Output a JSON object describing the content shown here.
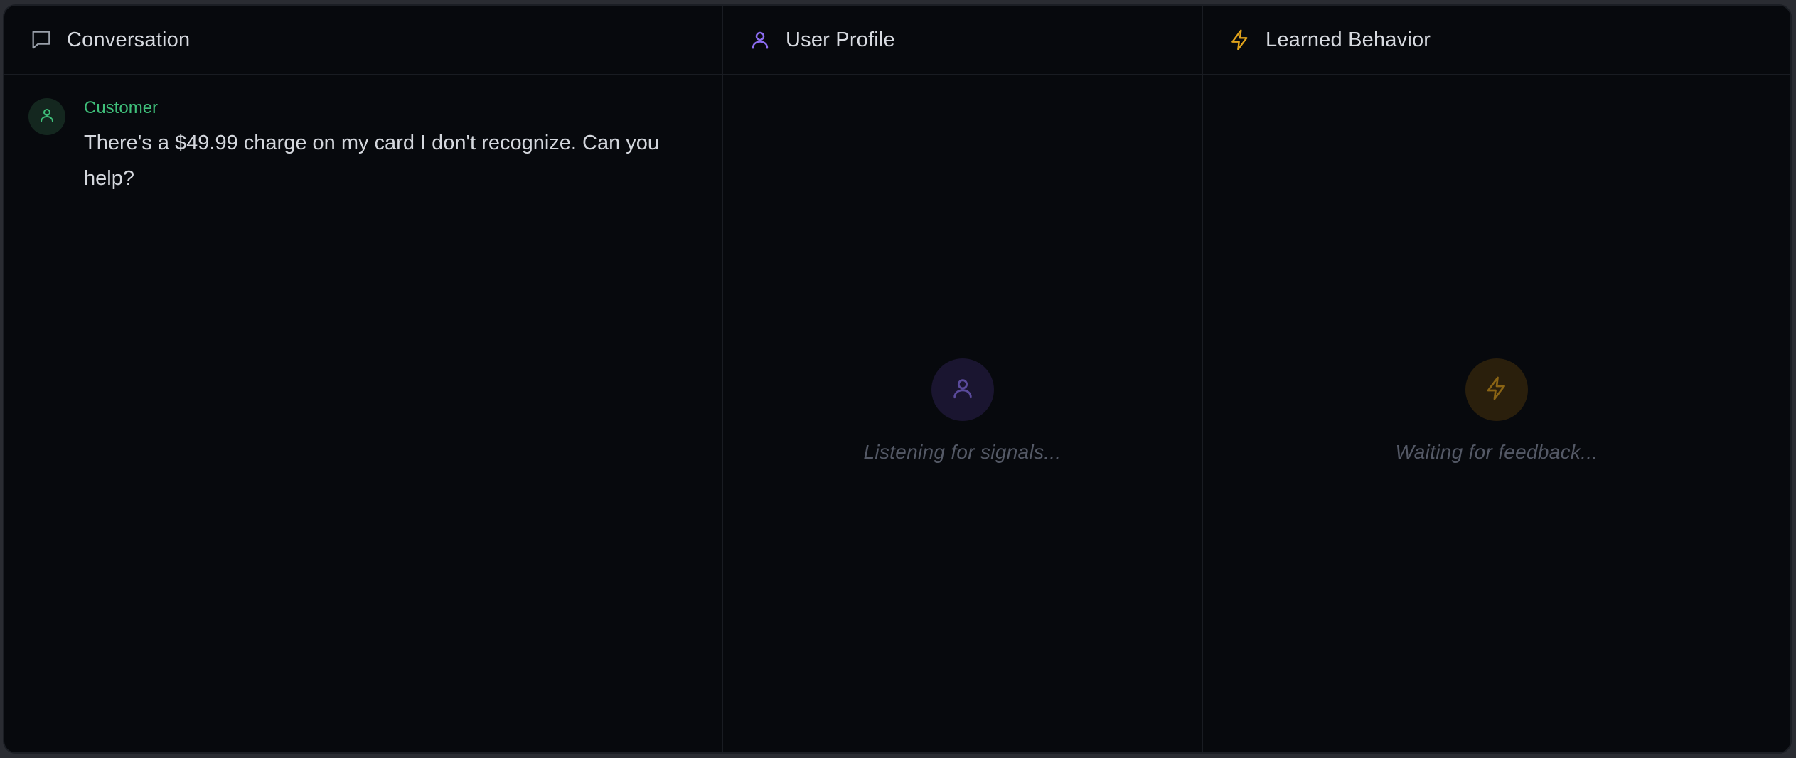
{
  "colors": {
    "background": "#07090d",
    "border": "#191c22",
    "customer_green": "#3fbf7a",
    "profile_purple": "#8b6cf0",
    "learned_amber": "#e0a21b"
  },
  "panels": {
    "conversation": {
      "title": "Conversation",
      "icon": "chat-bubble-icon",
      "messages": [
        {
          "sender": "Customer",
          "avatar_icon": "user-icon",
          "text": "There's a $49.99 charge on my card I don't recognize. Can you help?"
        }
      ]
    },
    "user_profile": {
      "title": "User Profile",
      "icon": "user-icon",
      "empty_icon": "user-icon",
      "empty_text": "Listening for signals..."
    },
    "learned_behavior": {
      "title": "Learned Behavior",
      "icon": "lightning-bolt-icon",
      "empty_icon": "lightning-bolt-icon",
      "empty_text": "Waiting for feedback..."
    }
  }
}
